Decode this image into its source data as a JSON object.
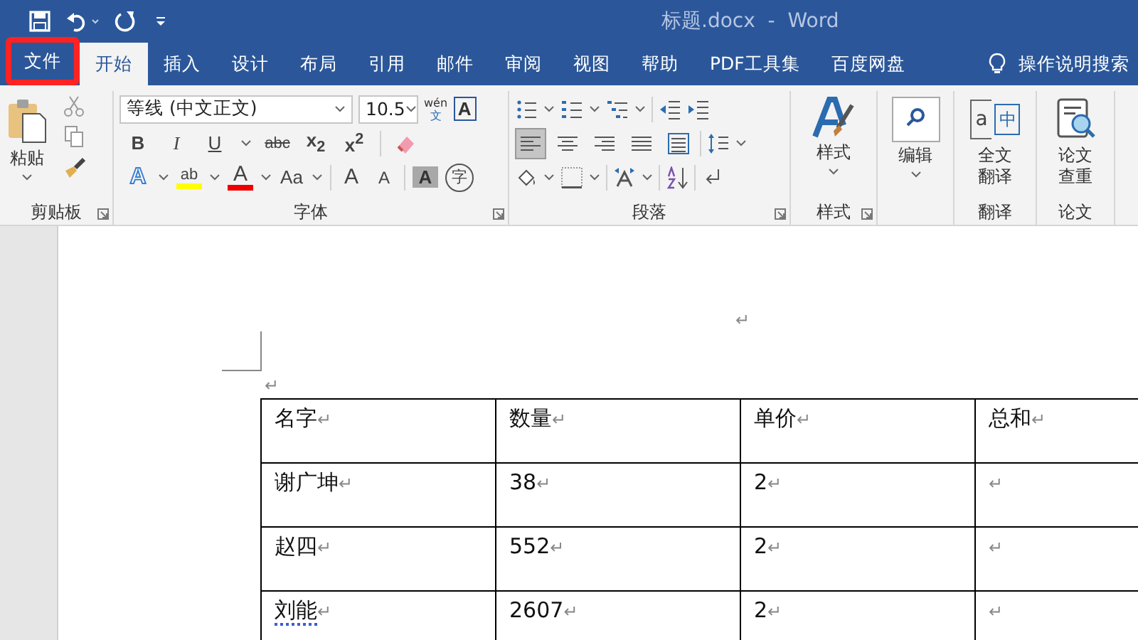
{
  "window": {
    "title": "标题.docx  -  Word"
  },
  "tabs": [
    {
      "label": "文件",
      "selected": false,
      "highlighted": true
    },
    {
      "label": "开始",
      "selected": true,
      "highlighted": false
    },
    {
      "label": "插入",
      "selected": false,
      "highlighted": false
    },
    {
      "label": "设计",
      "selected": false,
      "highlighted": false
    },
    {
      "label": "布局",
      "selected": false,
      "highlighted": false
    },
    {
      "label": "引用",
      "selected": false,
      "highlighted": false
    },
    {
      "label": "邮件",
      "selected": false,
      "highlighted": false
    },
    {
      "label": "审阅",
      "selected": false,
      "highlighted": false
    },
    {
      "label": "视图",
      "selected": false,
      "highlighted": false
    },
    {
      "label": "帮助",
      "selected": false,
      "highlighted": false
    },
    {
      "label": "PDF工具集",
      "selected": false,
      "highlighted": false
    },
    {
      "label": "百度网盘",
      "selected": false,
      "highlighted": false
    }
  ],
  "tell_me": "操作说明搜索",
  "ribbon": {
    "clipboard": {
      "paste": "粘贴",
      "label": "剪贴板"
    },
    "font": {
      "font_name": "等线 (中文正文)",
      "font_size": "10.5",
      "phonetic_top": "wén",
      "phonetic_bottom": "文",
      "border_char": "A",
      "format_buttons": [
        {
          "text": "B",
          "kind": "bold"
        },
        {
          "text": "I",
          "kind": "italic"
        },
        {
          "text": "U",
          "kind": "underline"
        },
        {
          "text": "abc",
          "kind": "strike"
        },
        {
          "text": "x$_{2}$",
          "kind": "sub"
        },
        {
          "text": "x$^{2}$",
          "kind": "sup"
        }
      ],
      "effect_buttons": [
        {
          "text": "A",
          "kind": "outline"
        },
        {
          "text": "ab",
          "kind": "highlight"
        },
        {
          "text": "A",
          "kind": "color"
        },
        {
          "text": "Aa",
          "kind": "case"
        },
        {
          "text": "A",
          "kind": "grow"
        },
        {
          "text": "A",
          "kind": "shrink"
        },
        {
          "text": "A",
          "kind": "shaded"
        },
        {
          "text": "字",
          "kind": "circled"
        }
      ],
      "label": "字体"
    },
    "paragraph": {
      "align_buttons": [
        {
          "kind": "left",
          "selected": true
        },
        {
          "kind": "center",
          "selected": false
        },
        {
          "kind": "right",
          "selected": false
        },
        {
          "kind": "justify",
          "selected": false
        },
        {
          "kind": "distributed",
          "selected": false
        }
      ],
      "label": "段落"
    },
    "styles": {
      "button": "样式",
      "label": "样式"
    },
    "editing": {
      "button": "编辑"
    },
    "translate": {
      "icon_latin": "a",
      "icon_cjk": "中",
      "button": "全文翻译",
      "label": "翻译"
    },
    "paper": {
      "button": "论文查重",
      "label": "论文"
    }
  },
  "document": {
    "top_mark": "↵",
    "second_mark": "↵",
    "table": [
      [
        {
          "text": "名字",
          "mark": "↵",
          "flagged": false
        },
        {
          "text": "数量",
          "mark": "↵",
          "flagged": false
        },
        {
          "text": "单价",
          "mark": "↵",
          "flagged": false
        },
        {
          "text": "总和",
          "mark": "↵",
          "flagged": false
        }
      ],
      [
        {
          "text": "谢广坤",
          "mark": "↵",
          "flagged": false
        },
        {
          "text": "38",
          "mark": "↵",
          "flagged": false
        },
        {
          "text": "2",
          "mark": "↵",
          "flagged": false
        },
        {
          "mark": "↵",
          "flagged": false
        }
      ],
      [
        {
          "text": "赵四",
          "mark": "↵",
          "flagged": false
        },
        {
          "text": "552",
          "mark": "↵",
          "flagged": false
        },
        {
          "text": "2",
          "mark": "↵",
          "flagged": false
        },
        {
          "mark": "↵",
          "flagged": false
        }
      ],
      [
        {
          "text": "刘能",
          "mark": "↵",
          "flagged": true
        },
        {
          "text": "2607",
          "mark": "↵",
          "flagged": false
        },
        {
          "text": "2",
          "mark": "↵",
          "flagged": false
        },
        {
          "mark": "↵",
          "flagged": false
        }
      ]
    ]
  }
}
